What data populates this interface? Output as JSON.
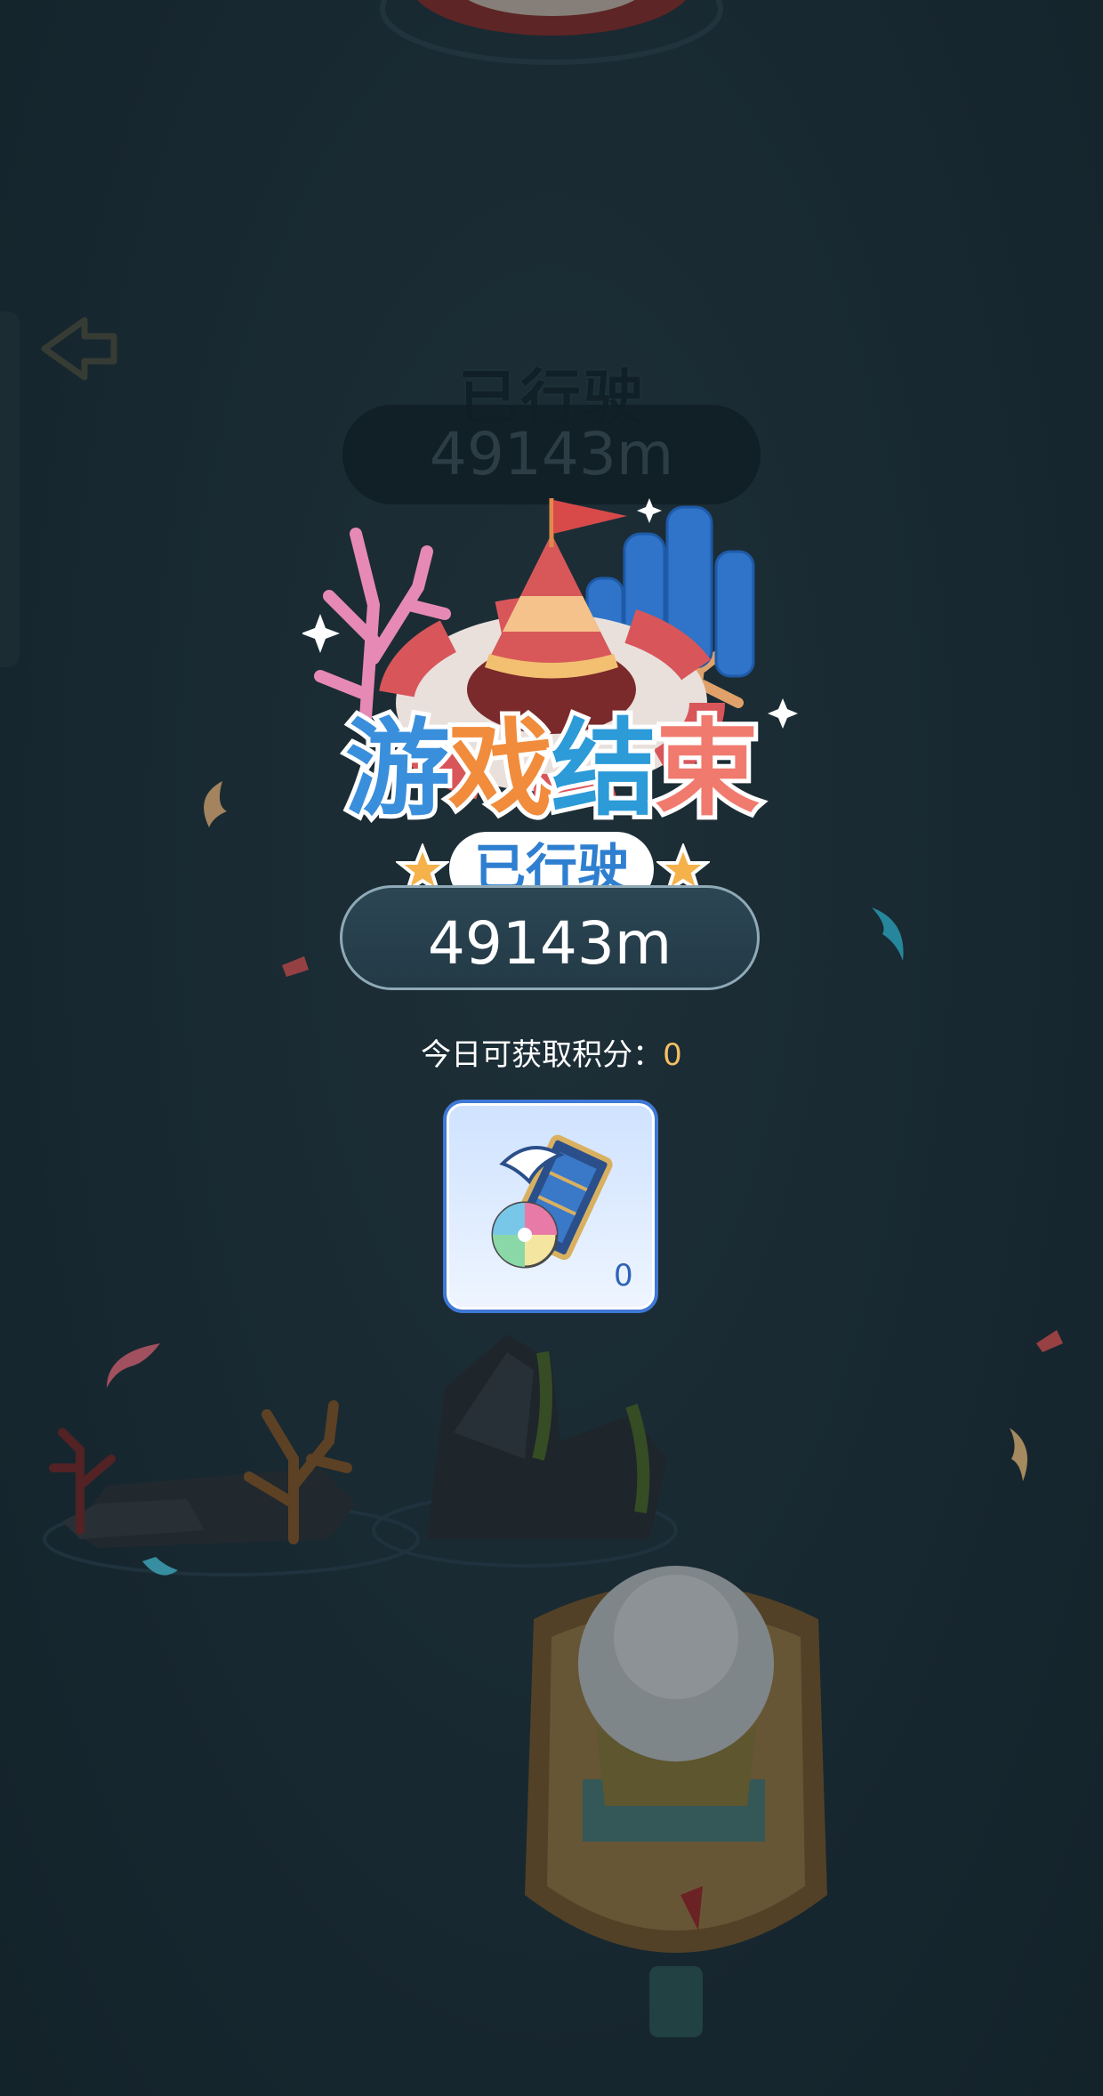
{
  "hud": {
    "distance_label": "已行驶",
    "distance_value": "49143m"
  },
  "result": {
    "title_chars": [
      "游",
      "戏",
      "结",
      "束"
    ],
    "subtitle": "已行驶",
    "distance_value": "49143m"
  },
  "points": {
    "label": "今日可获取积分：",
    "value": "0"
  },
  "reward": {
    "icon": "beach-ball-card-icon",
    "count": "0"
  },
  "colors": {
    "background": "#223640",
    "accent_blue": "#3f78d6",
    "points_gold": "#f3c063"
  }
}
